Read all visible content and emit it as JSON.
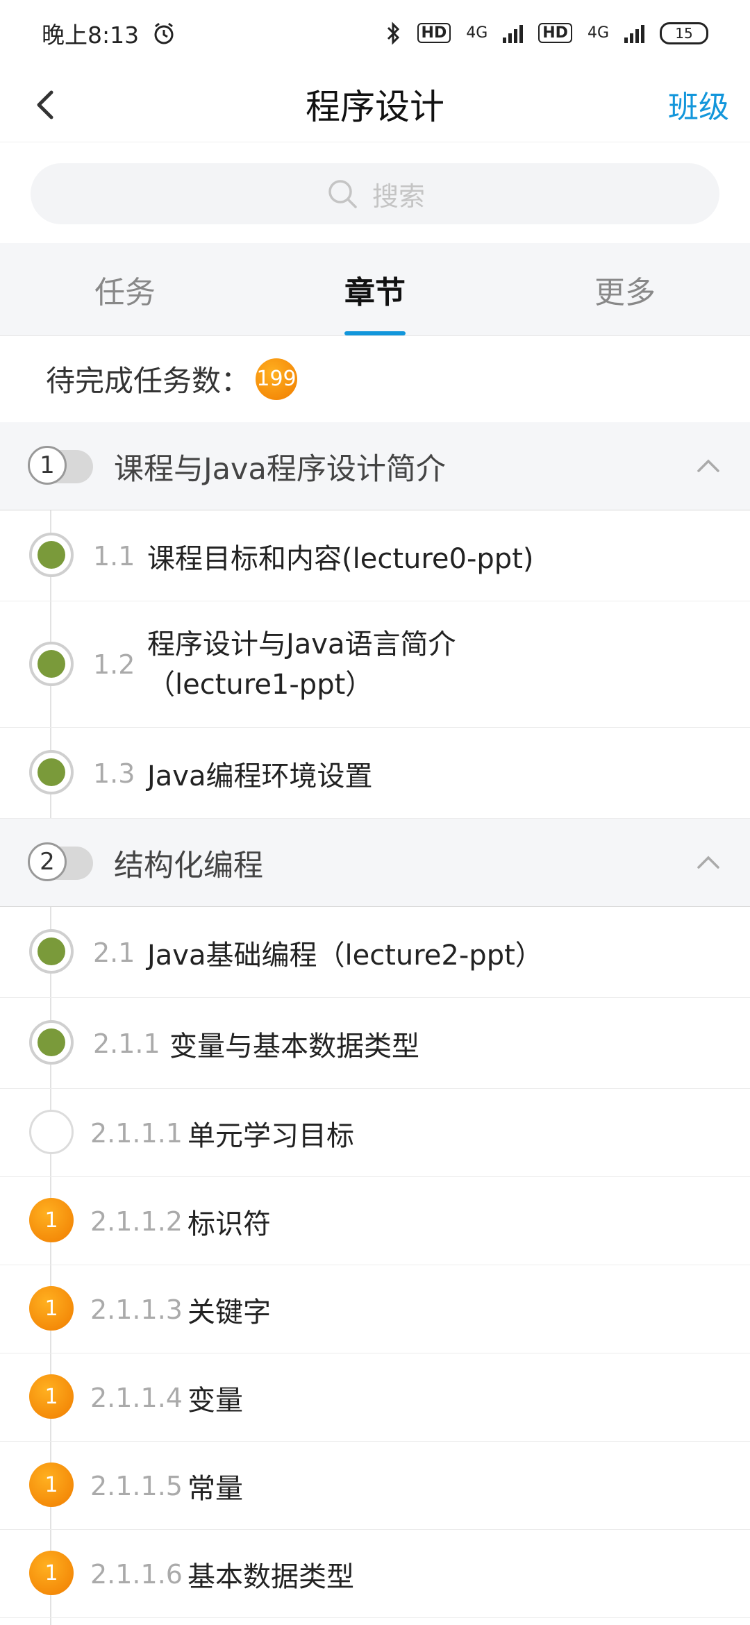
{
  "status": {
    "time": "晚上8:13",
    "net1": "4G",
    "net2": "4G",
    "hd1": "HD",
    "hd2": "HD",
    "battery": "15"
  },
  "header": {
    "title": "程序设计",
    "right_link": "班级"
  },
  "search": {
    "placeholder": "搜索"
  },
  "tabs": [
    {
      "label": "任务"
    },
    {
      "label": "章节"
    },
    {
      "label": "更多"
    }
  ],
  "pending": {
    "label": "待完成任务数：",
    "count": "199"
  },
  "chapters": [
    {
      "num": "1",
      "title": "课程与Java程序设计简介"
    },
    {
      "num": "2",
      "title": "结构化编程"
    }
  ],
  "items": [
    {
      "num": "1.1",
      "label": "课程目标和内容(lecture0-ppt)",
      "status": "done"
    },
    {
      "num": "1.2",
      "label": "程序设计与Java语言简介",
      "label2": "（lecture1-ppt）",
      "status": "done"
    },
    {
      "num": "1.3",
      "label": "Java编程环境设置",
      "status": "done"
    },
    {
      "num": "2.1",
      "label": "Java基础编程（lecture2-ppt）",
      "status": "done"
    },
    {
      "num": "2.1.1",
      "label": "变量与基本数据类型",
      "status": "done"
    },
    {
      "num": "2.1.1.1",
      "label": "单元学习目标",
      "status": "empty"
    },
    {
      "num": "2.1.1.2",
      "label": "标识符",
      "status": "pending",
      "badge": "1"
    },
    {
      "num": "2.1.1.3",
      "label": "关键字",
      "status": "pending",
      "badge": "1"
    },
    {
      "num": "2.1.1.4",
      "label": "变量",
      "status": "pending",
      "badge": "1"
    },
    {
      "num": "2.1.1.5",
      "label": "常量",
      "status": "pending",
      "badge": "1"
    },
    {
      "num": "2.1.1.6",
      "label": "基本数据类型",
      "status": "pending",
      "badge": "1"
    }
  ],
  "colors": {
    "accent": "#1296db",
    "done": "#7a9a3a",
    "pending": "#f08c00"
  }
}
